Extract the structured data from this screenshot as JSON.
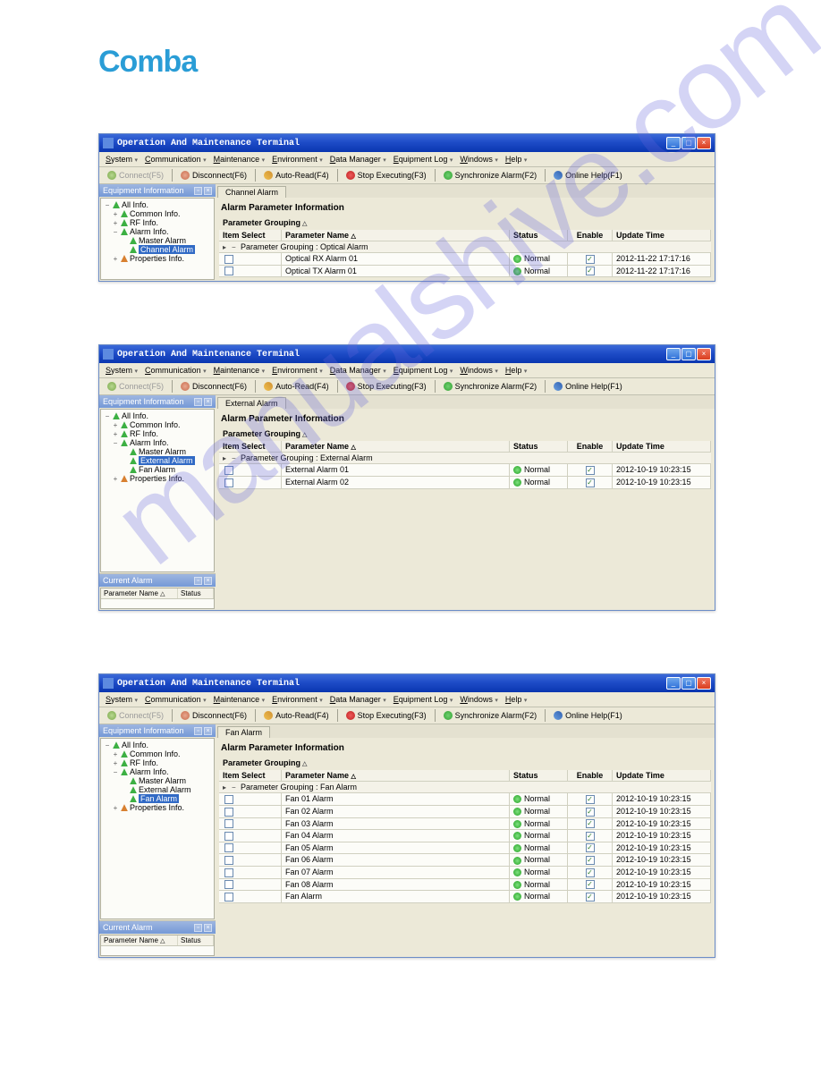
{
  "logo": "Comba",
  "window_title": "Operation And Maintenance Terminal",
  "menus": [
    "System",
    "Communication",
    "Maintenance",
    "Environment",
    "Data Manager",
    "Equipment Log",
    "Windows",
    "Help"
  ],
  "toolbar": {
    "connect": "Connect(F5)",
    "disconnect": "Disconnect(F6)",
    "autoread": "Auto-Read(F4)",
    "stop": "Stop Executing(F3)",
    "sync": "Synchronize Alarm(F2)",
    "help": "Online Help(F1)"
  },
  "sidebar": {
    "title": "Equipment Information",
    "tree": {
      "root": "All Info.",
      "common": "Common Info.",
      "rf": "RF Info.",
      "alarm": "Alarm Info.",
      "master": "Master Alarm",
      "channel": "Channel Alarm",
      "external": "External Alarm",
      "fan": "Fan Alarm",
      "properties": "Properties Info."
    },
    "current_alarm": "Current Alarm",
    "col_param": "Parameter Name",
    "col_status": "Status"
  },
  "content": {
    "section_title": "Alarm Parameter Information",
    "group_title": "Parameter Grouping",
    "columns": {
      "item": "Item Select",
      "param": "Parameter Name",
      "status": "Status",
      "enable": "Enable",
      "update": "Update Time"
    }
  },
  "screens": [
    {
      "tab": "Channel Alarm",
      "group": "Parameter Grouping : Optical Alarm",
      "selected_tree": "channel",
      "has_alarm_panel": false,
      "height_class": "short",
      "rows": [
        {
          "name": "Optical RX Alarm 01",
          "status": "Normal",
          "update": "2012-11-22 17:17:16"
        },
        {
          "name": "Optical TX Alarm 01",
          "status": "Normal",
          "update": "2012-11-22 17:17:16"
        }
      ],
      "show_channel": true
    },
    {
      "tab": "External Alarm",
      "group": "Parameter Grouping : External Alarm",
      "selected_tree": "external",
      "has_alarm_panel": true,
      "height_class": "tall",
      "rows": [
        {
          "name": "External Alarm 01",
          "status": "Normal",
          "update": "2012-10-19 10:23:15"
        },
        {
          "name": "External Alarm 02",
          "status": "Normal",
          "update": "2012-10-19 10:23:15"
        }
      ],
      "show_channel": false
    },
    {
      "tab": "Fan Alarm",
      "group": "Parameter Grouping : Fan Alarm",
      "selected_tree": "fan",
      "has_alarm_panel": true,
      "height_class": "taller",
      "rows": [
        {
          "name": "Fan 01 Alarm",
          "status": "Normal",
          "update": "2012-10-19 10:23:15"
        },
        {
          "name": "Fan 02 Alarm",
          "status": "Normal",
          "update": "2012-10-19 10:23:15"
        },
        {
          "name": "Fan 03 Alarm",
          "status": "Normal",
          "update": "2012-10-19 10:23:15"
        },
        {
          "name": "Fan 04 Alarm",
          "status": "Normal",
          "update": "2012-10-19 10:23:15"
        },
        {
          "name": "Fan 05 Alarm",
          "status": "Normal",
          "update": "2012-10-19 10:23:15"
        },
        {
          "name": "Fan 06 Alarm",
          "status": "Normal",
          "update": "2012-10-19 10:23:15"
        },
        {
          "name": "Fan 07 Alarm",
          "status": "Normal",
          "update": "2012-10-19 10:23:15"
        },
        {
          "name": "Fan 08 Alarm",
          "status": "Normal",
          "update": "2012-10-19 10:23:15"
        },
        {
          "name": "Fan Alarm",
          "status": "Normal",
          "update": "2012-10-19 10:23:15"
        }
      ],
      "show_channel": false
    }
  ]
}
